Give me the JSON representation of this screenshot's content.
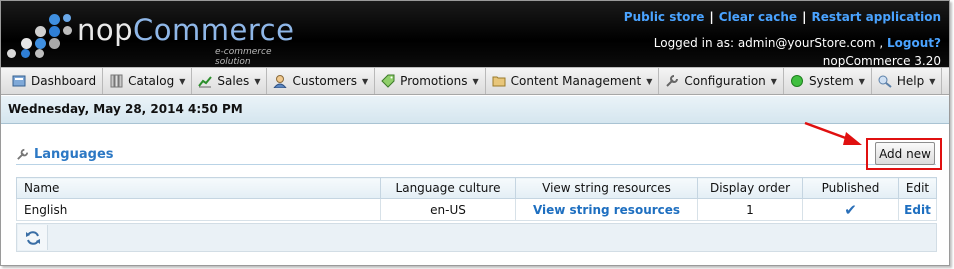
{
  "brand": {
    "name_part1": "nop",
    "name_part2": "Commerce",
    "tagline": "e-commerce solution"
  },
  "top_links": {
    "public_store": "Public store",
    "clear_cache": "Clear cache",
    "restart": "Restart application",
    "separator": "|"
  },
  "account": {
    "logged_in_label": "Logged in as: admin@yourStore.com ,",
    "logout": "Logout?",
    "version": "nopCommerce 3.20"
  },
  "menu": [
    {
      "label": "Dashboard",
      "icon": "dashboard-icon",
      "caret": false
    },
    {
      "label": "Catalog",
      "icon": "catalog-icon",
      "caret": true
    },
    {
      "label": "Sales",
      "icon": "sales-icon",
      "caret": true
    },
    {
      "label": "Customers",
      "icon": "customers-icon",
      "caret": true
    },
    {
      "label": "Promotions",
      "icon": "promotions-icon",
      "caret": true
    },
    {
      "label": "Content Management",
      "icon": "folder-icon",
      "caret": true
    },
    {
      "label": "Configuration",
      "icon": "wrench-icon",
      "caret": true
    },
    {
      "label": "System",
      "icon": "system-icon",
      "caret": true
    },
    {
      "label": "Help",
      "icon": "help-icon",
      "caret": true
    }
  ],
  "date_text": "Wednesday, May 28, 2014 4:50 PM",
  "page": {
    "title": "Languages",
    "add_new": "Add new"
  },
  "grid": {
    "columns": [
      "Name",
      "Language culture",
      "View string resources",
      "Display order",
      "Published",
      "Edit"
    ],
    "rows": [
      {
        "name": "English",
        "culture": "en-US",
        "resources": "View string resources",
        "order": "1",
        "published": "✔",
        "edit": "Edit"
      }
    ]
  },
  "colors": {
    "link": "#1e6fc0",
    "header_link": "#4aa3ff",
    "highlight": "#e01010"
  }
}
